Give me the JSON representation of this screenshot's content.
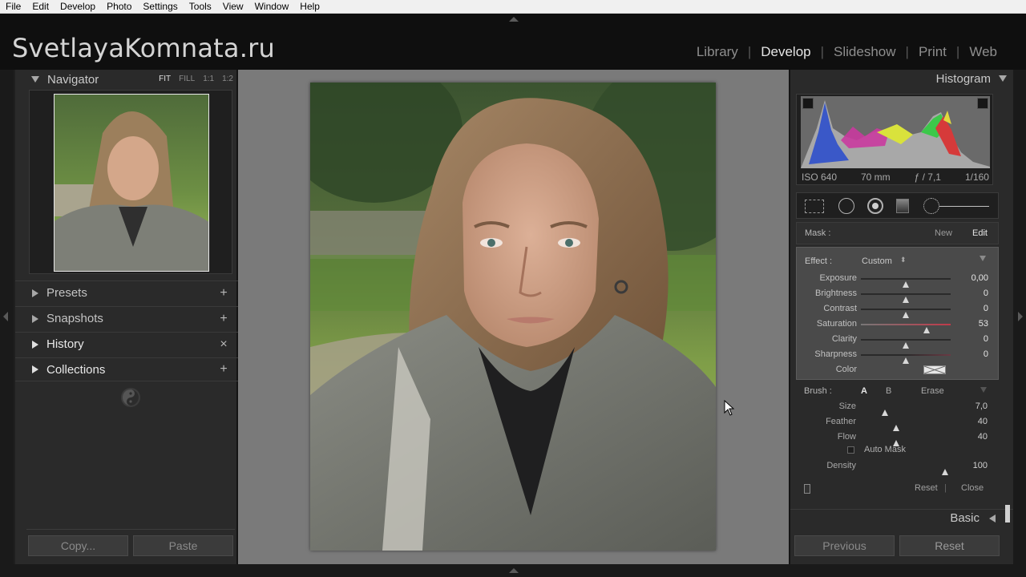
{
  "menu": [
    "File",
    "Edit",
    "Develop",
    "Photo",
    "Settings",
    "Tools",
    "View",
    "Window",
    "Help"
  ],
  "brand": "SvetlayaKomnata.ru",
  "modules": [
    {
      "label": "Library",
      "active": false
    },
    {
      "label": "Develop",
      "active": true
    },
    {
      "label": "Slideshow",
      "active": false
    },
    {
      "label": "Print",
      "active": false
    },
    {
      "label": "Web",
      "active": false
    }
  ],
  "left": {
    "navigator": {
      "title": "Navigator",
      "zoom": [
        "FIT",
        "FILL",
        "1:1",
        "1:2"
      ]
    },
    "sections": [
      {
        "label": "Presets",
        "action": "+"
      },
      {
        "label": "Snapshots",
        "action": "+"
      },
      {
        "label": "History",
        "action": "×"
      },
      {
        "label": "Collections",
        "action": "+"
      }
    ],
    "copy_label": "Copy...",
    "paste_label": "Paste"
  },
  "right": {
    "histogram": {
      "title": "Histogram",
      "iso": "ISO 640",
      "focal": "70 mm",
      "aperture": "ƒ / 7,1",
      "shutter": "1/160"
    },
    "mask": {
      "label": "Mask :",
      "new": "New",
      "edit": "Edit"
    },
    "effect": {
      "label": "Effect :",
      "value": "Custom",
      "sliders": [
        {
          "label": "Exposure",
          "value": "0,00",
          "pos": 0.5
        },
        {
          "label": "Brightness",
          "value": "0",
          "pos": 0.5
        },
        {
          "label": "Contrast",
          "value": "0",
          "pos": 0.5
        },
        {
          "label": "Saturation",
          "value": "53",
          "pos": 0.73
        },
        {
          "label": "Clarity",
          "value": "0",
          "pos": 0.5
        },
        {
          "label": "Sharpness",
          "value": "0",
          "pos": 0.5
        }
      ],
      "color_label": "Color"
    },
    "brush": {
      "label": "Brush :",
      "a": "A",
      "b": "B",
      "erase": "Erase",
      "sliders": [
        {
          "label": "Size",
          "value": "7,0",
          "pos": 0.28
        },
        {
          "label": "Feather",
          "value": "40",
          "pos": 0.4
        },
        {
          "label": "Flow",
          "value": "40",
          "pos": 0.4
        }
      ],
      "auto_mask": "Auto Mask",
      "density": {
        "label": "Density",
        "value": "100",
        "pos": 0.95
      },
      "reset": "Reset",
      "close": "Close"
    },
    "basic": "Basic",
    "previous_label": "Previous",
    "reset_label": "Reset"
  }
}
